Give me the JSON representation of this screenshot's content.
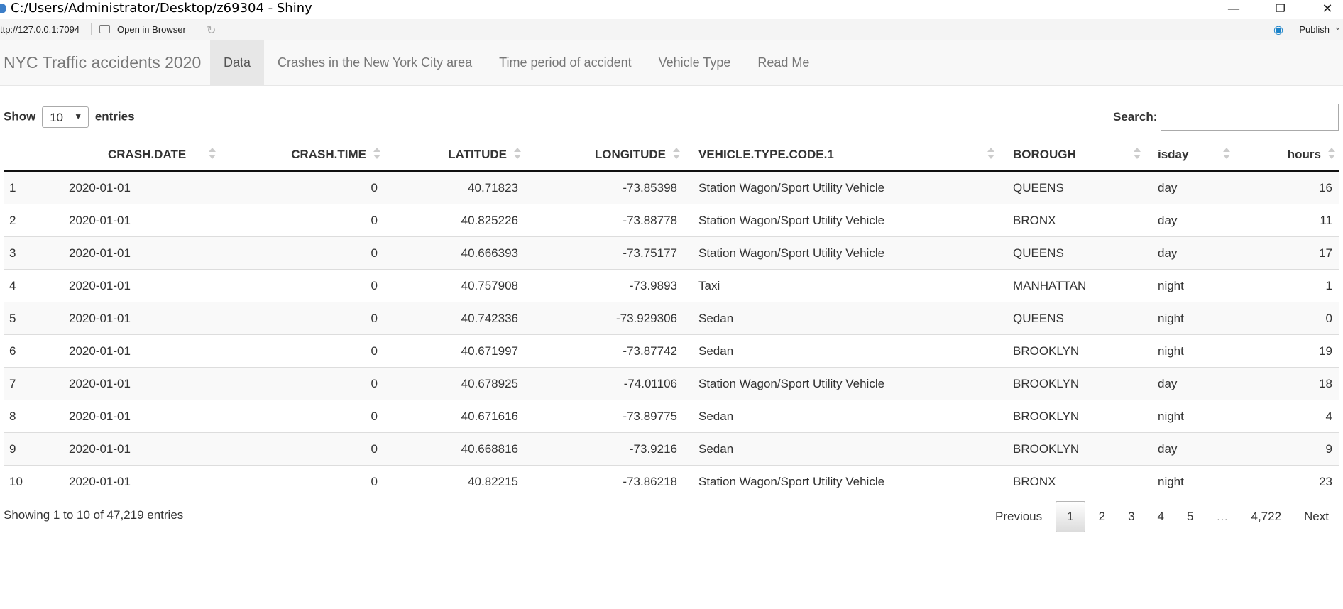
{
  "window": {
    "title": "C:/Users/Administrator/Desktop/z69304 - Shiny",
    "minimize": "—",
    "restore": "❐",
    "close": "✕"
  },
  "toolbar": {
    "url": "ttp://127.0.0.1:7094",
    "open_in_browser": "Open in Browser",
    "publish": "Publish"
  },
  "navbar": {
    "brand": "NYC Traffic accidents 2020",
    "tabs": [
      "Data",
      "Crashes in the New York City area",
      "Time period of accident",
      "Vehicle Type",
      "Read Me"
    ],
    "active_tab": "Data"
  },
  "controls": {
    "show_label": "Show",
    "entries_label": "entries",
    "page_length": "10",
    "search_label": "Search:",
    "search_value": ""
  },
  "table": {
    "columns": [
      "",
      "CRASH.DATE",
      "CRASH.TIME",
      "LATITUDE",
      "LONGITUDE",
      "VEHICLE.TYPE.CODE.1",
      "BOROUGH",
      "isday",
      "hours"
    ],
    "rows": [
      [
        "1",
        "2020-01-01",
        "0",
        "40.71823",
        "-73.85398",
        "Station Wagon/Sport Utility Vehicle",
        "QUEENS",
        "day",
        "16"
      ],
      [
        "2",
        "2020-01-01",
        "0",
        "40.825226",
        "-73.88778",
        "Station Wagon/Sport Utility Vehicle",
        "BRONX",
        "day",
        "11"
      ],
      [
        "3",
        "2020-01-01",
        "0",
        "40.666393",
        "-73.75177",
        "Station Wagon/Sport Utility Vehicle",
        "QUEENS",
        "day",
        "17"
      ],
      [
        "4",
        "2020-01-01",
        "0",
        "40.757908",
        "-73.9893",
        "Taxi",
        "MANHATTAN",
        "night",
        "1"
      ],
      [
        "5",
        "2020-01-01",
        "0",
        "40.742336",
        "-73.929306",
        "Sedan",
        "QUEENS",
        "night",
        "0"
      ],
      [
        "6",
        "2020-01-01",
        "0",
        "40.671997",
        "-73.87742",
        "Sedan",
        "BROOKLYN",
        "night",
        "19"
      ],
      [
        "7",
        "2020-01-01",
        "0",
        "40.678925",
        "-74.01106",
        "Station Wagon/Sport Utility Vehicle",
        "BROOKLYN",
        "day",
        "18"
      ],
      [
        "8",
        "2020-01-01",
        "0",
        "40.671616",
        "-73.89775",
        "Sedan",
        "BROOKLYN",
        "night",
        "4"
      ],
      [
        "9",
        "2020-01-01",
        "0",
        "40.668816",
        "-73.9216",
        "Sedan",
        "BROOKLYN",
        "day",
        "9"
      ],
      [
        "10",
        "2020-01-01",
        "0",
        "40.82215",
        "-73.86218",
        "Station Wagon/Sport Utility Vehicle",
        "BRONX",
        "night",
        "23"
      ]
    ]
  },
  "footer": {
    "info": "Showing 1 to 10 of 47,219 entries",
    "previous": "Previous",
    "pages": [
      "1",
      "2",
      "3",
      "4",
      "5",
      "…",
      "4,722"
    ],
    "current_page": "1",
    "next": "Next"
  }
}
